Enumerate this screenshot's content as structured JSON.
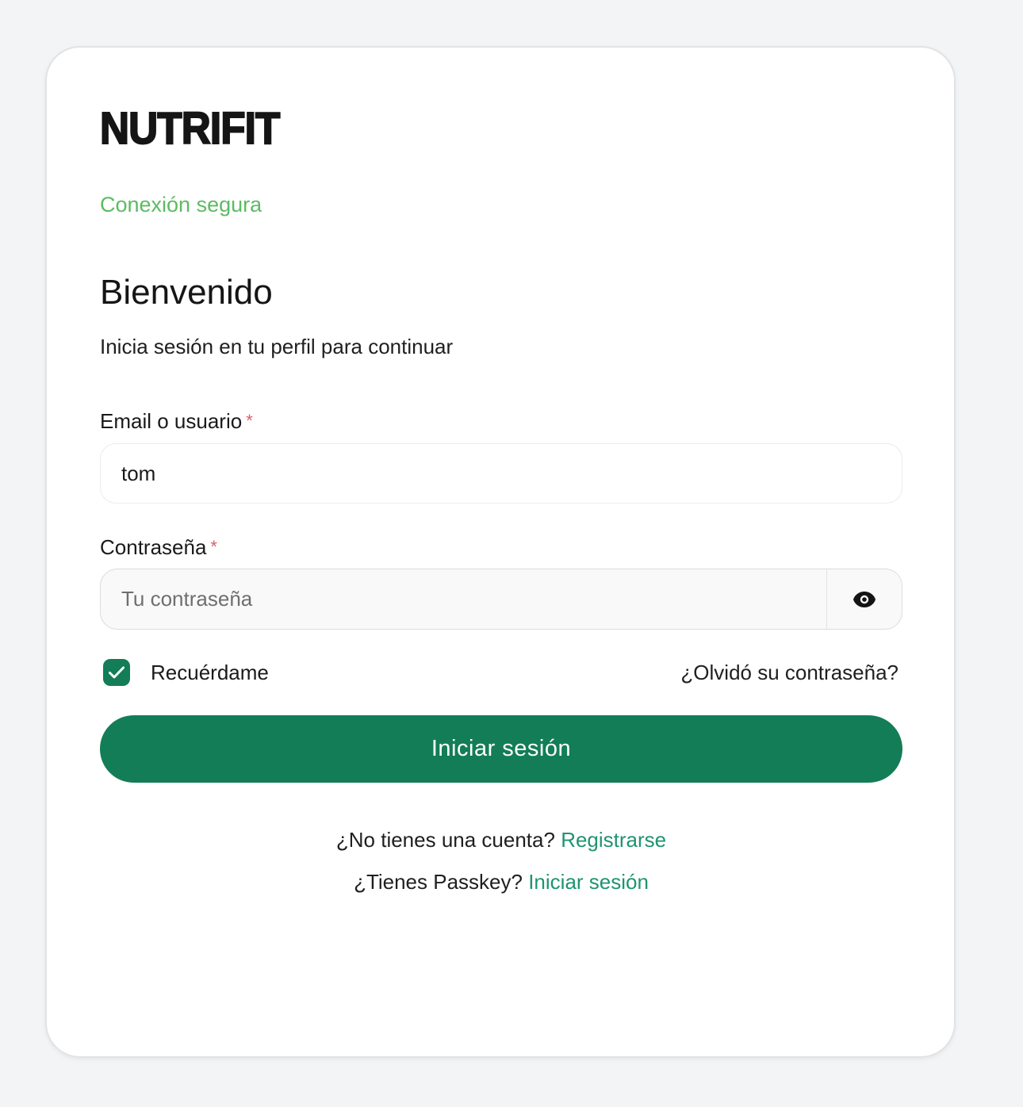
{
  "brand": {
    "logo_text": "NUTRIFIT",
    "secure_text": "Conexión segura"
  },
  "header": {
    "title": "Bienvenido",
    "subtitle": "Inicia sesión en tu perfil para continuar"
  },
  "form": {
    "email_label": "Email o usuario",
    "email_value": "tom",
    "password_label": "Contraseña",
    "password_placeholder": "Tu contraseña",
    "required_marker": "*",
    "toggle_icon": "eye-icon",
    "remember_label": "Recuérdame",
    "remember_checked": true,
    "forgot_link": "¿Olvidó su contraseña?",
    "submit_label": "Iniciar sesión"
  },
  "footer": {
    "no_account_text": "¿No tienes una cuenta?",
    "register_link": "Registrarse",
    "passkey_text": "¿Tienes Passkey?",
    "passkey_link": "Iniciar sesión"
  },
  "colors": {
    "accent": "#137d57",
    "link": "#1f9470",
    "secure": "#5dbb63",
    "required": "#e05a6b",
    "background": "#f3f4f6"
  }
}
